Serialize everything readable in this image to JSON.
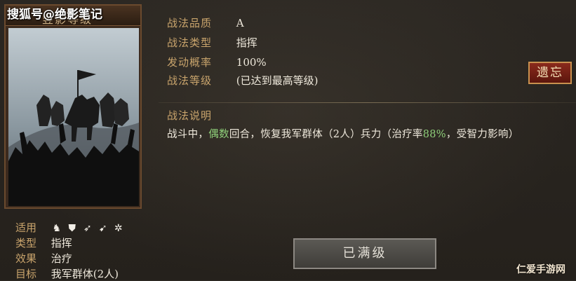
{
  "watermark": "搜狐号@绝影笔记",
  "card": {
    "title": "竖影等级"
  },
  "info": {
    "rows": [
      {
        "key": "适用",
        "value": ""
      },
      {
        "key": "类型",
        "value": "指挥"
      },
      {
        "key": "效果",
        "value": "治疗"
      },
      {
        "key": "目标",
        "value": "我军群体(2人)"
      }
    ],
    "arm_icons": [
      "cavalry-icon",
      "shield-icon",
      "bow-icon",
      "spear-icon",
      "wheel-icon"
    ]
  },
  "stats": {
    "rows": [
      {
        "key": "战法品质",
        "value": "A"
      },
      {
        "key": "战法类型",
        "value": "指挥"
      },
      {
        "key": "发动概率",
        "value": "100%"
      },
      {
        "key": "战法等级",
        "value": "(已达到最高等级)"
      }
    ]
  },
  "description": {
    "title": "战法说明",
    "text_pre": "战斗中，",
    "text_green1": "偶数",
    "text_mid": "回合，恢复我军群体（2人）兵力（治疗率",
    "text_green2": "88%",
    "text_post": "，受智力影响）"
  },
  "buttons": {
    "legacy": "遗忘",
    "max_level": "已满级"
  },
  "corner_watermark": "仁爱手游网",
  "colors": {
    "accent_gold": "#c9a46c",
    "green_highlight": "#8fd07a",
    "legacy_red": "#8a2a1c"
  }
}
